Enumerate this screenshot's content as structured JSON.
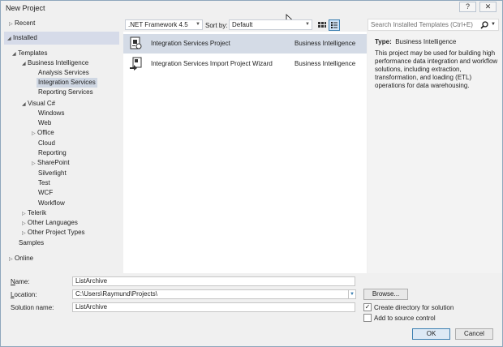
{
  "window": {
    "title": "New Project",
    "help_glyph": "?",
    "close_glyph": "✕"
  },
  "left": {
    "recent": "Recent",
    "installed": "Installed",
    "templates": "Templates",
    "business_intelligence": "Business Intelligence",
    "analysis_services": "Analysis Services",
    "integration_services": "Integration Services",
    "reporting_services": "Reporting Services",
    "visual_csharp": "Visual C#",
    "windows": "Windows",
    "web": "Web",
    "office": "Office",
    "cloud": "Cloud",
    "reporting": "Reporting",
    "sharepoint": "SharePoint",
    "silverlight": "Silverlight",
    "test": "Test",
    "wcf": "WCF",
    "workflow": "Workflow",
    "telerik": "Telerik",
    "other_languages": "Other Languages",
    "other_project_types": "Other Project Types",
    "samples": "Samples",
    "online": "Online"
  },
  "toolbar": {
    "framework": ".NET Framework 4.5",
    "sort_label": "Sort by:",
    "sort_value": "Default"
  },
  "templates": [
    {
      "name": "Integration Services Project",
      "category": "Business Intelligence"
    },
    {
      "name": "Integration Services Import Project Wizard",
      "category": "Business Intelligence"
    }
  ],
  "search": {
    "placeholder": "Search Installed Templates (Ctrl+E)"
  },
  "detail": {
    "type_label": "Type:",
    "type_value": "Business Intelligence",
    "description": "This project may be used for building high performance data integration and workflow solutions, including extraction, transformation, and loading (ETL) operations for data warehousing."
  },
  "form": {
    "name_label": "Name:",
    "name_value": "ListArchive",
    "location_label": "Location:",
    "location_value": "C:\\Users\\Raymund\\Projects\\",
    "solution_label": "Solution name:",
    "solution_value": "ListArchive",
    "browse_label": "Browse...",
    "create_dir_label": "Create directory for solution",
    "create_dir_checked": true,
    "source_control_label": "Add to source control",
    "source_control_checked": false,
    "ok_label": "OK",
    "cancel_label": "Cancel"
  },
  "icons": [
    "collapsed-arrow-icon",
    "expanded-arrow-icon",
    "medium-icons-view-icon",
    "list-view-icon",
    "search-icon",
    "ssis-project-icon",
    "import-wizard-icon"
  ]
}
